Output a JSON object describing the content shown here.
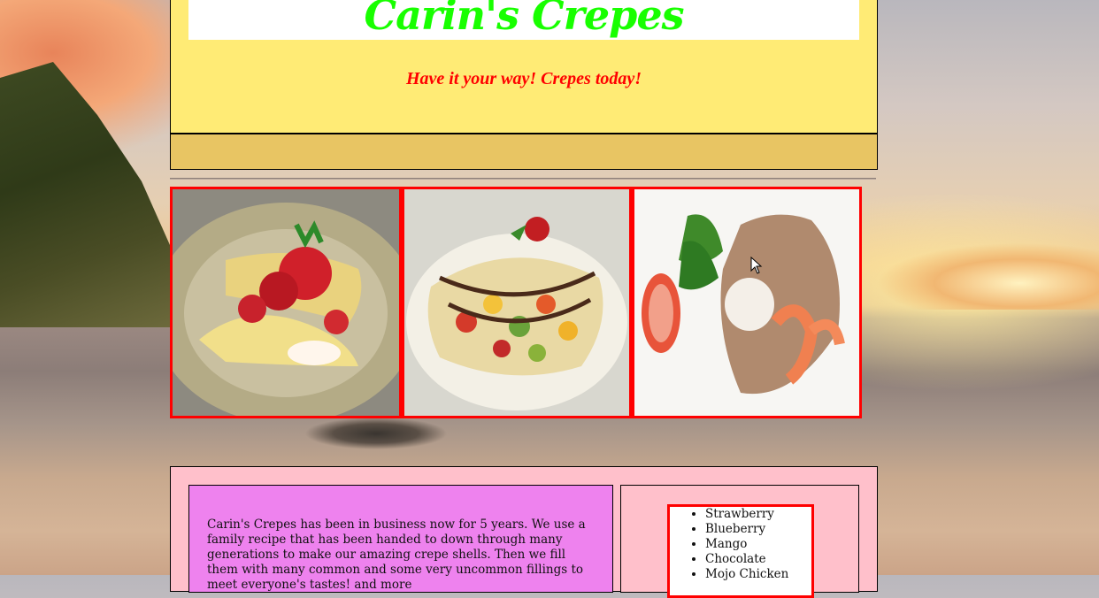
{
  "site": {
    "title": "Carin's Crepes",
    "tagline": "Have it your way! Crepes today!"
  },
  "gallery": [
    {
      "name": "strawberry-crepe-photo"
    },
    {
      "name": "fruit-chocolate-crepe-photo"
    },
    {
      "name": "shrimp-savory-crepe-photo"
    }
  ],
  "about": {
    "text": "Carin's Crepes has been in business now for 5 years. We use a family recipe that has been handed to down through many generations to make our amazing crepe shells. Then we fill them with many common and some very uncommon fillings to meet everyone's tastes! and more"
  },
  "flavors": [
    "Strawberry",
    "Blueberry",
    "Mango",
    "Chocolate",
    "Mojo Chicken"
  ],
  "colors": {
    "header_bg": "#ffeb75",
    "title": "#18ff00",
    "tagline": "#ff0000",
    "nav_bg": "#e8c563",
    "content_bg": "#ffc0cb",
    "about_bg": "#ee82ee",
    "frame": "#ff0000"
  }
}
